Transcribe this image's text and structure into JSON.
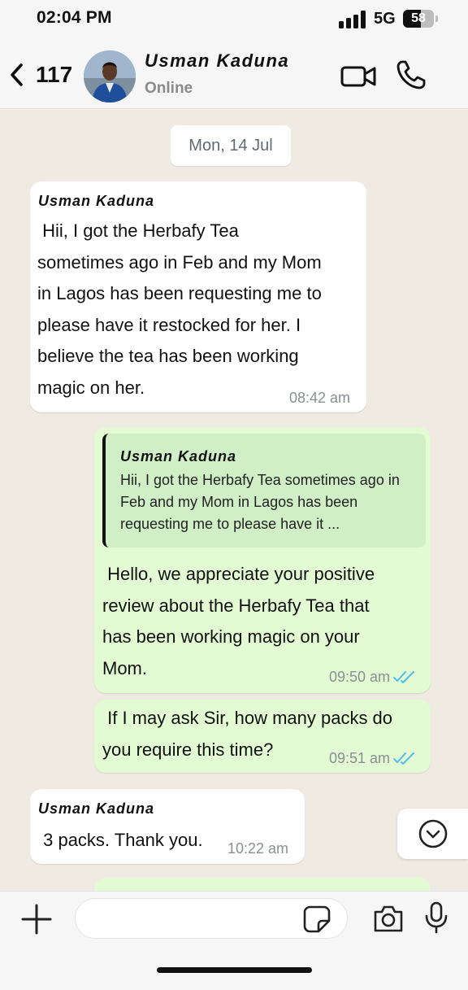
{
  "status_bar": {
    "time": "02:04 PM",
    "network": "5G",
    "battery": "58",
    "battery_level": 0.58
  },
  "header": {
    "back_count": "117",
    "contact_name": "Usman Kaduna",
    "status": "Online"
  },
  "chat": {
    "date_chip": "Mon, 14 Jul",
    "messages": [
      {
        "direction": "incoming",
        "sender": "Usman Kaduna",
        "lines": [
          " Hii, I got the Herbafy Tea",
          "sometimes ago in Feb and my Mom",
          "in Lagos has been requesting me to",
          "please have it restocked for her. I",
          "believe the tea has been working",
          "magic on her."
        ],
        "time": "08:42 am"
      },
      {
        "direction": "outgoing",
        "quote_sender": "Usman Kaduna",
        "quote_lines": [
          "Hii, I got the Herbafy Tea sometimes ago in",
          "Feb and my Mom in Lagos has been",
          "requesting me to please have it ..."
        ],
        "lines": [
          " Hello, we appreciate your positive",
          "review about the Herbafy Tea that",
          "has been working magic on your",
          "Mom."
        ],
        "time": "09:50 am",
        "read": true
      },
      {
        "direction": "outgoing",
        "lines": [
          " If I may ask Sir, how many packs do",
          "you require this time?"
        ],
        "time": "09:51 am",
        "read": true
      },
      {
        "direction": "incoming",
        "sender": "Usman Kaduna",
        "lines": [
          " 3 packs. Thank you."
        ],
        "time": "10:22 am"
      }
    ]
  },
  "input": {
    "placeholder": ""
  },
  "colors": {
    "incoming_bubble": "#ffffff",
    "outgoing_bubble": "#e2fbd3",
    "quote_bg": "#d0efc6",
    "read_ticks": "#53bdeb",
    "chat_bg": "#efeae2"
  },
  "icons": [
    "back-chevron-icon",
    "video-call-icon",
    "phone-call-icon",
    "chevron-down-icon",
    "plus-icon",
    "sticker-icon",
    "camera-icon",
    "microphone-icon",
    "signal-icon",
    "battery-icon"
  ]
}
